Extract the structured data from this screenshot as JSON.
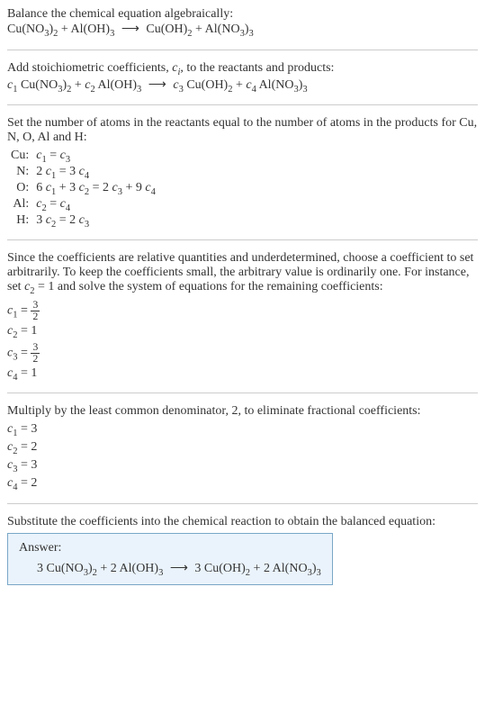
{
  "intro": {
    "line1": "Balance the chemical equation algebraically:",
    "eq_lhs1": "Cu(NO",
    "eq_lhs1_sub1": "3",
    "eq_lhs1_close": ")",
    "eq_lhs1_sub2": "2",
    "eq_plus1": " + Al(OH)",
    "eq_lhs2_sub": "3",
    "eq_arrow": "⟶",
    "eq_rhs1": "Cu(OH)",
    "eq_rhs1_sub": "2",
    "eq_plus2": " + Al(NO",
    "eq_rhs2_sub1": "3",
    "eq_rhs2_close": ")",
    "eq_rhs2_sub2": "3"
  },
  "stoich": {
    "line1_a": "Add stoichiometric coefficients, ",
    "line1_ci": "c",
    "line1_i": "i",
    "line1_b": ", to the reactants and products:",
    "c1": "c",
    "c1_sub": "1",
    "sp1": " Cu(NO",
    "sp1_sub1": "3",
    "sp1_close": ")",
    "sp1_sub2": "2",
    "plus1": " + ",
    "c2": "c",
    "c2_sub": "2",
    "sp2": " Al(OH)",
    "sp2_sub": "3",
    "arrow": "⟶",
    "c3": "c",
    "c3_sub": "3",
    "sp3": " Cu(OH)",
    "sp3_sub": "2",
    "plus2": " + ",
    "c4": "c",
    "c4_sub": "4",
    "sp4": " Al(NO",
    "sp4_sub1": "3",
    "sp4_close": ")",
    "sp4_sub2": "3"
  },
  "atoms": {
    "intro": "Set the number of atoms in the reactants equal to the number of atoms in the products for Cu, N, O, Al and H:",
    "rows": [
      {
        "el": "Cu:",
        "lhs_a": "c",
        "lhs_a_sub": "1",
        "eq": " = ",
        "rhs_a": "c",
        "rhs_a_sub": "3",
        "rhs_extra": ""
      },
      {
        "el": "N:",
        "lhs_pre": "2 ",
        "lhs_a": "c",
        "lhs_a_sub": "1",
        "eq": " = ",
        "rhs_pre": "3 ",
        "rhs_a": "c",
        "rhs_a_sub": "4"
      },
      {
        "el": "O:",
        "lhs_pre": "6 ",
        "lhs_a": "c",
        "lhs_a_sub": "1",
        "lhs_plus": " + 3 ",
        "lhs_b": "c",
        "lhs_b_sub": "2",
        "eq": " = ",
        "rhs_pre": "2 ",
        "rhs_a": "c",
        "rhs_a_sub": "3",
        "rhs_plus": " + 9 ",
        "rhs_b": "c",
        "rhs_b_sub": "4"
      },
      {
        "el": "Al:",
        "lhs_a": "c",
        "lhs_a_sub": "2",
        "eq": " = ",
        "rhs_a": "c",
        "rhs_a_sub": "4"
      },
      {
        "el": "H:",
        "lhs_pre": "3 ",
        "lhs_a": "c",
        "lhs_a_sub": "2",
        "eq": " = ",
        "rhs_pre": "2 ",
        "rhs_a": "c",
        "rhs_a_sub": "3"
      }
    ]
  },
  "underdet": {
    "text_a": "Since the coefficients are relative quantities and underdetermined, choose a coefficient to set arbitrarily. To keep the coefficients small, the arbitrary value is ordinarily one. For instance, set ",
    "c2": "c",
    "c2_sub": "2",
    "text_b": " = 1 and solve the system of equations for the remaining coefficients:",
    "c1_lhs": "c",
    "c1_sub": "1",
    "c1_eq": " = ",
    "c1_num": "3",
    "c1_den": "2",
    "c2_lhs": "c",
    "c2_lhs_sub": "2",
    "c2_val": " = 1",
    "c3_lhs": "c",
    "c3_sub": "3",
    "c3_eq": " = ",
    "c3_num": "3",
    "c3_den": "2",
    "c4_lhs": "c",
    "c4_sub": "4",
    "c4_val": " = 1"
  },
  "lcd": {
    "text": "Multiply by the least common denominator, 2, to eliminate fractional coefficients:",
    "c1": "c",
    "c1_sub": "1",
    "c1_val": " = 3",
    "c2": "c",
    "c2_sub": "2",
    "c2_val": " = 2",
    "c3": "c",
    "c3_sub": "3",
    "c3_val": " = 3",
    "c4": "c",
    "c4_sub": "4",
    "c4_val": " = 2"
  },
  "final": {
    "text": "Substitute the coefficients into the chemical reaction to obtain the balanced equation:",
    "answer_label": "Answer:",
    "eq_a": "3 Cu(NO",
    "eq_a_sub1": "3",
    "eq_a_close": ")",
    "eq_a_sub2": "2",
    "eq_plus1": " + 2 Al(OH)",
    "eq_b_sub": "3",
    "arrow": "⟶",
    "eq_c": "3 Cu(OH)",
    "eq_c_sub": "2",
    "eq_plus2": " + 2 Al(NO",
    "eq_d_sub1": "3",
    "eq_d_close": ")",
    "eq_d_sub2": "3"
  },
  "chart_data": {
    "type": "table",
    "title": "Atom balance equations",
    "rows": [
      {
        "element": "Cu",
        "equation": "c1 = c3"
      },
      {
        "element": "N",
        "equation": "2 c1 = 3 c4"
      },
      {
        "element": "O",
        "equation": "6 c1 + 3 c2 = 2 c3 + 9 c4"
      },
      {
        "element": "Al",
        "equation": "c2 = c4"
      },
      {
        "element": "H",
        "equation": "3 c2 = 2 c3"
      }
    ],
    "solution_arbitrary": {
      "c1": "3/2",
      "c2": 1,
      "c3": "3/2",
      "c4": 1
    },
    "solution_integer": {
      "c1": 3,
      "c2": 2,
      "c3": 3,
      "c4": 2
    },
    "balanced_equation": "3 Cu(NO3)2 + 2 Al(OH)3 -> 3 Cu(OH)2 + 2 Al(NO3)3"
  }
}
